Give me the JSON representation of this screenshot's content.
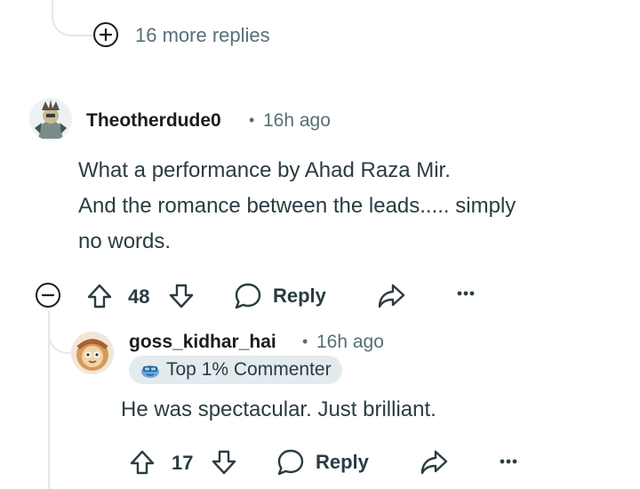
{
  "thread": {
    "more_replies": {
      "label": "16 more replies",
      "icon": "plus-circle-icon"
    }
  },
  "comment": {
    "username": "Theotherdude0",
    "separator": "•",
    "timestamp": "16h ago",
    "body_lines": [
      "What a performance by Ahad Raza Mir.",
      "And the romance between the leads..... simply",
      "no words."
    ],
    "actions": {
      "collapse_icon": "minus-circle-icon",
      "upvote_icon": "upvote-arrow-icon",
      "votes": "48",
      "downvote_icon": "downvote-arrow-icon",
      "reply_icon": "chat-bubble-icon",
      "reply_label": "Reply",
      "share_icon": "share-arrow-icon",
      "more_icon": "ellipsis-icon"
    }
  },
  "reply": {
    "username": "goss_kidhar_hai",
    "separator": "•",
    "timestamp": "16h ago",
    "badge": {
      "label": "Top 1% Commenter",
      "icon": "top-commenter-badge-icon"
    },
    "body": "He was spectacular. Just brilliant.",
    "actions": {
      "upvote_icon": "upvote-arrow-icon",
      "votes": "17",
      "downvote_icon": "downvote-arrow-icon",
      "reply_icon": "chat-bubble-icon",
      "reply_label": "Reply",
      "share_icon": "share-arrow-icon",
      "more_icon": "ellipsis-icon"
    }
  },
  "colors": {
    "text_primary": "#1c1c1c",
    "text_secondary": "#576f76",
    "thread_line": "#e5e8ea",
    "badge_bg": "#e4ebee"
  }
}
